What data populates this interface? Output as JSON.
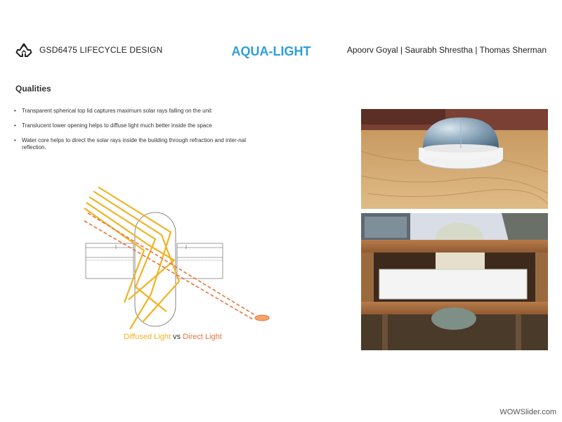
{
  "header": {
    "logo_icon": "recycle-icon",
    "course": "GSD6475 LIFECYCLE DESIGN",
    "title": "AQUA-LIGHT",
    "authors": "Apoorv Goyal | Saurabh Shrestha | Thomas Sherman"
  },
  "section": {
    "title": "Qualities",
    "bullets": [
      "Transparent spherical top lid captures maximum solar rays falling on the unit",
      "Translucent lower opening helps to diffuse light much better inside the space",
      "Water core helps to direct the solar rays inside the building through refraction and inter-nal reflection."
    ]
  },
  "diagram": {
    "caption_diffused": "Diffused Light",
    "caption_vs": " vs ",
    "caption_direct": "Direct Light",
    "colors": {
      "diffused": "#f0b323",
      "direct": "#e8743b"
    }
  },
  "watermark": "WOWSlider.com"
}
